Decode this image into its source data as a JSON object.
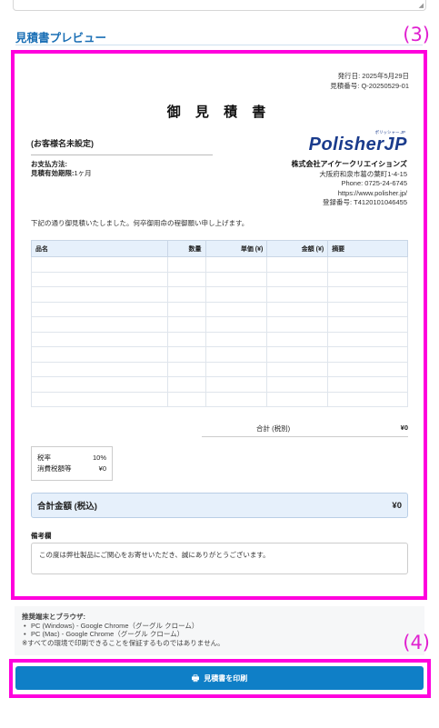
{
  "section": {
    "title": "見積書プレビュー"
  },
  "markers": {
    "preview": "(3)",
    "print": "(4)"
  },
  "quote": {
    "issue_date": "発行日: 2025年5月29日",
    "quote_number": "見積番号: Q-20250529-01",
    "title": "御 見 積 書",
    "customer": "(お客様名未設定)",
    "payment_label": "お支払方法:",
    "payment_value": "",
    "validity_label": "見積有効期限:",
    "validity_value": "1ヶ月",
    "logo_text": "PolisherJP",
    "logo_sub": "ポリッシャー.JP",
    "company_name": "株式会社アイケークリエイションズ",
    "address": "大阪府和泉市葛の葉町1-4-15",
    "phone": "Phone: 0725-24-6745",
    "website": "https://www.polisher.jp/",
    "registration": "登録番号: T4120101046455",
    "greeting": "下記の通り御見積いたしました。何卒御用命の程御願い申し上げます。",
    "table": {
      "headers": [
        "品名",
        "数量",
        "単価 (¥)",
        "金額 (¥)",
        "摘要"
      ],
      "rows": [
        [
          "",
          "",
          "",
          "",
          ""
        ],
        [
          "",
          "",
          "",
          "",
          ""
        ],
        [
          "",
          "",
          "",
          "",
          ""
        ],
        [
          "",
          "",
          "",
          "",
          ""
        ],
        [
          "",
          "",
          "",
          "",
          ""
        ],
        [
          "",
          "",
          "",
          "",
          ""
        ],
        [
          "",
          "",
          "",
          "",
          ""
        ],
        [
          "",
          "",
          "",
          "",
          ""
        ],
        [
          "",
          "",
          "",
          "",
          ""
        ],
        [
          "",
          "",
          "",
          "",
          ""
        ]
      ]
    },
    "subtotal_label": "合計 (税別)",
    "subtotal_value": "¥0",
    "tax_rate_label": "税率",
    "tax_rate_value": "10%",
    "tax_amount_label": "消費税額等",
    "tax_amount_value": "¥0",
    "grand_total_label": "合計金額 (税込)",
    "grand_total_value": "¥0",
    "remarks_label": "備考欄",
    "remarks_text": "この度は弊社製品にご関心をお寄せいただき、誠にありがとうございます。"
  },
  "notes": {
    "head": "推奨端末とブラウザ:",
    "items": [
      "PC (Windows) - Google Chrome（グーグル クローム）",
      "PC (Mac) - Google Chrome（グーグル クローム）"
    ],
    "disclaimer": "※すべての環境で印刷できることを保証するものではありません。"
  },
  "print_button": {
    "label": "見積書を印刷",
    "icon": "print-icon"
  },
  "colors": {
    "accent": "#0f7fc7",
    "highlight_frame": "#ff00dd",
    "logo": "#1a3b8c"
  }
}
